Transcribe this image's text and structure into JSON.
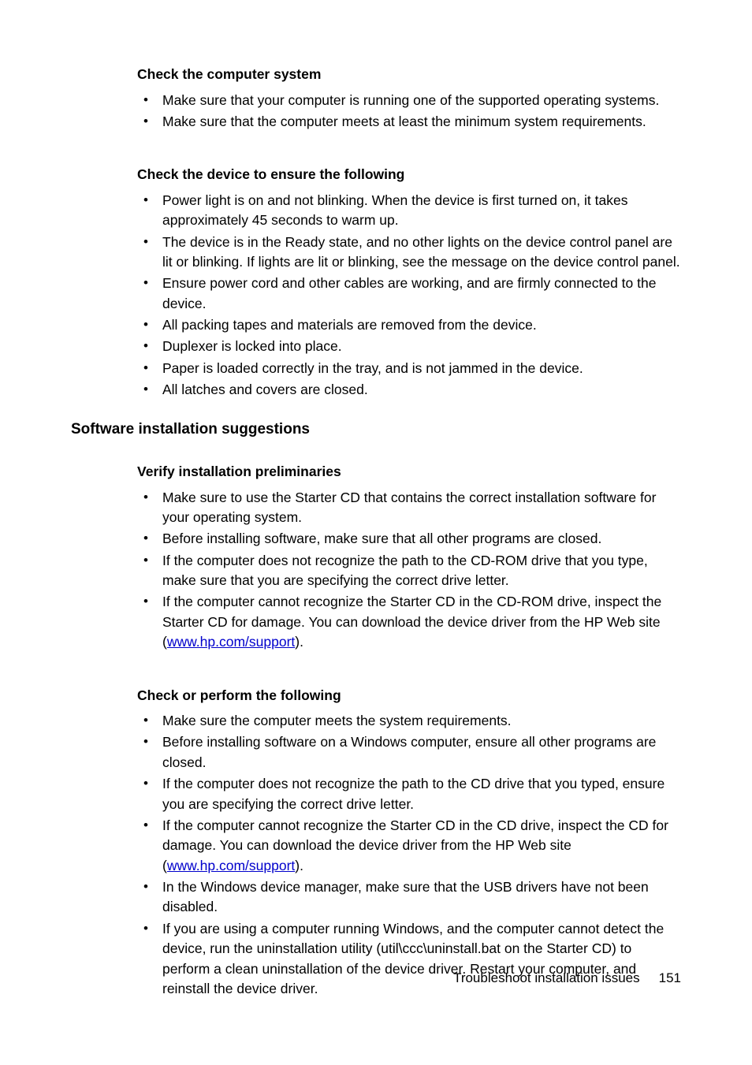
{
  "sections": {
    "computer_system": {
      "heading": "Check the computer system",
      "items": [
        "Make sure that your computer is running one of the supported operating systems.",
        "Make sure that the computer meets at least the minimum system requirements."
      ]
    },
    "device_following": {
      "heading": "Check the device to ensure the following",
      "items": [
        "Power light is on and not blinking. When the device is first turned on, it takes approximately 45 seconds to warm up.",
        "The device is in the Ready state, and no other lights on the device control panel are lit or blinking. If lights are lit or blinking, see the message on the device control panel.",
        "Ensure power cord and other cables are working, and are firmly connected to the device.",
        "All packing tapes and materials are removed from the device.",
        "Duplexer is locked into place.",
        "Paper is loaded correctly in the tray, and is not jammed in the device.",
        "All latches and covers are closed."
      ]
    },
    "software_heading": "Software installation suggestions",
    "verify_prelim": {
      "heading": "Verify installation preliminaries",
      "items": {
        "i0": "Make sure to use the Starter CD that contains the correct installation software for your operating system.",
        "i1": "Before installing software, make sure that all other programs are closed.",
        "i2": "If the computer does not recognize the path to the CD-ROM drive that you type, make sure that you are specifying the correct drive letter.",
        "i3_pre": "If the computer cannot recognize the Starter CD in the CD-ROM drive, inspect the Starter CD for damage. You can download the device driver from the HP Web site (",
        "i3_link": "www.hp.com/support",
        "i3_post": ")."
      }
    },
    "check_perform": {
      "heading": "Check or perform the following",
      "items": {
        "i0": "Make sure the computer meets the system requirements.",
        "i1": "Before installing software on a Windows computer, ensure all other programs are closed.",
        "i2": "If the computer does not recognize the path to the CD drive that you typed, ensure you are specifying the correct drive letter.",
        "i3_pre": "If the computer cannot recognize the Starter CD in the CD drive, inspect the CD for damage. You can download the device driver from the HP Web site (",
        "i3_link_a": "www.hp.com/",
        "i3_link_b": "support",
        "i3_post": ").",
        "i4": "In the Windows device manager, make sure that the USB drivers have not been disabled.",
        "i5": "If you are using a computer running Windows, and the computer cannot detect the device, run the uninstallation utility (util\\ccc\\uninstall.bat on the Starter CD) to perform a clean uninstallation of the device driver. Restart your computer, and reinstall the device driver."
      }
    }
  },
  "footer": {
    "label": "Troubleshoot installation issues",
    "page": "151"
  }
}
